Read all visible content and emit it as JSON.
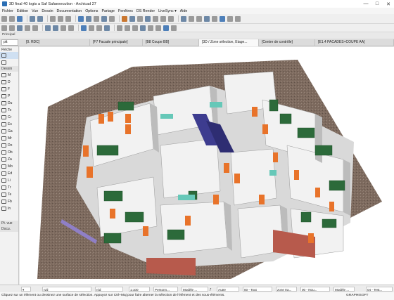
{
  "window": {
    "title": "3D final 40 logts a Saf Safaexecution - Archicad 27",
    "controls": [
      "—",
      "□",
      "✕"
    ]
  },
  "menu": [
    "Fichier",
    "Edition",
    "Vue",
    "Dessin",
    "Documentation",
    "Options",
    "Partage",
    "Fenêtres",
    "DS Render",
    "LiveSync ▾",
    "Aide"
  ],
  "infobar": {
    "label": "Principal"
  },
  "layer_selector": "ptt",
  "tabs": [
    {
      "label": "[0. RDC]",
      "active": false
    },
    {
      "label": "[F7 Facade principale]",
      "active": false
    },
    {
      "label": "[B8 Coupe BB]",
      "active": false
    },
    {
      "label": "[3D / Zone sélection, Etage...",
      "active": true
    },
    {
      "label": "[Centre de contrôle]",
      "active": false
    },
    {
      "label": "[E1.4 PACADES+COUPE AA]",
      "active": false
    }
  ],
  "toolbox": {
    "header": "Flèche",
    "section": "Dessin",
    "items": [
      "M",
      "D",
      "F",
      "P",
      "Du",
      "To",
      "Cr",
      "Es",
      "Ga",
      "Mr",
      "Do",
      "Ob",
      "Za",
      "Mo",
      "Ed",
      "Li",
      "Tr",
      "Te",
      "Fb",
      "In"
    ],
    "footer_1": "Pt. vue",
    "footer_2": "Docu."
  },
  "statusbar": {
    "undo_a": "n/d",
    "undo_b": "n/d",
    "scale": "1:100",
    "person": "Personn...",
    "model": "Modèle ...",
    "pct": "ƒ",
    "autre": "Autre",
    "all": "00 - Tout",
    "zone": "zone tra...",
    "nouveau": "00 - Nou...",
    "model2": "Modèle ...",
    "tests": "04 - Test..."
  },
  "hint": "Cliquez sur un élément ou dessinez une surface de sélection. Appuyez sur Ctrl+Maj pour faire alterner la sélection de l'élément et des sous-éléments.",
  "brand": "GRAPHISOFT",
  "colors": {
    "ground": "#7d6a5e",
    "wall": "#f2f2f2",
    "wall_shadow": "#bcbcbc",
    "door": "#e8732a",
    "furniture": "#2c6a3a",
    "stairs": "#3d3c8f",
    "accent_cyan": "#66c8b8",
    "brick": "#b75a4c"
  }
}
